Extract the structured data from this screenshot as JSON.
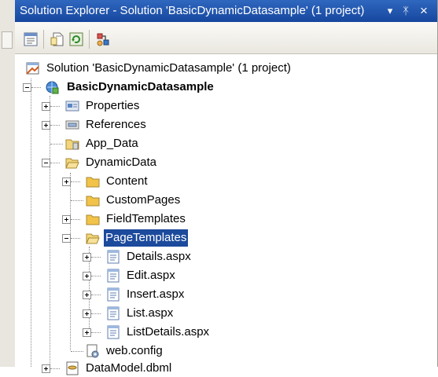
{
  "window": {
    "title": "Solution Explorer - Solution 'BasicDynamicDatasample' (1 project)",
    "dropdown_glyph": "▾",
    "pin_glyph": "ᛡ",
    "close_glyph": "×"
  },
  "toolbar": {
    "buttons": [
      "properties-icon",
      "show-all-files-icon",
      "refresh-icon",
      "view-class-diagram-icon"
    ]
  },
  "tree": {
    "solution": "Solution 'BasicDynamicDatasample' (1 project)",
    "project": "BasicDynamicDatasample",
    "properties": "Properties",
    "references": "References",
    "app_data": "App_Data",
    "dynamic_data": "DynamicData",
    "content": "Content",
    "custom_pages": "CustomPages",
    "field_templates": "FieldTemplates",
    "page_templates": "PageTemplates",
    "details": "Details.aspx",
    "edit": "Edit.aspx",
    "insert": "Insert.aspx",
    "list": "List.aspx",
    "list_details": "ListDetails.aspx",
    "web_config": "web.config",
    "data_model": "DataModel.dbml"
  },
  "colors": {
    "title_bar": "#1f53ac",
    "selection": "#1c4a9c",
    "folder": "#f2c349"
  }
}
